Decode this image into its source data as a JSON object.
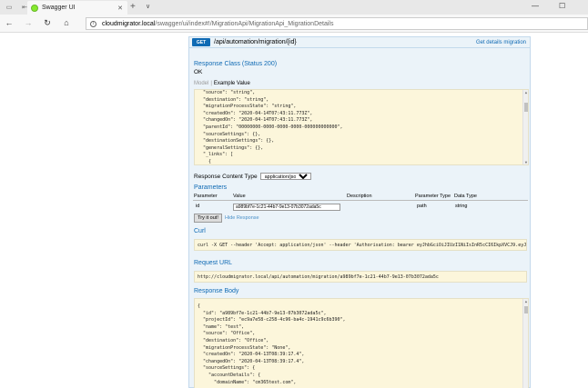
{
  "browser": {
    "tab_title": "Swagger UI",
    "url_host": "cloudmigrator.local",
    "url_path": "/swagger/ui/index#!/MigrationApi/MigrationApi_MigrationDetails"
  },
  "operation": {
    "method": "GET",
    "path": "/api/automation/migration/{id}",
    "summary": "Get details migration",
    "response_class_title": "Response Class (Status 200)",
    "response_class_value": "OK",
    "model_tab": "Model",
    "example_tab": "Example Value",
    "example_lines": [
      "  \"source\": \"string\",",
      "  \"destination\": \"string\",",
      "  \"migrationProcessState\": \"string\",",
      "  \"createdOn\": \"2020-04-14T07:43:11.773Z\",",
      "  \"changedOn\": \"2020-04-14T07:43:11.773Z\",",
      "  \"parentId\": \"00000000-0000-0000-0000-000000000000\",",
      "  \"sourceSettings\": {},",
      "  \"destinationSettings\": {},",
      "  \"generalSettings\": {},",
      "  \"_links\": [",
      "    {"
    ],
    "response_content_type_label": "Response Content Type",
    "response_content_type_value": "application/json",
    "parameters_title": "Parameters",
    "param_headers": {
      "parameter": "Parameter",
      "value": "Value",
      "description": "Description",
      "parameter_type": "Parameter Type",
      "data_type": "Data Type"
    },
    "param_row": {
      "name": "id",
      "value": "a989bf7e-1c21-44b7-9e13-07b3072ada5c",
      "parameter_type": "path",
      "data_type": "string"
    },
    "try_button": "Try it out!",
    "hide_response": "Hide Response",
    "curl_title": "Curl",
    "curl_text": "curl -X GET --header 'Accept: application/json' --header 'Authorisation: bearer eyJhbGciOiJIUzI1NiIsInR5cCI6IkpXVCJ9.eyJodHRwOi8vc",
    "request_url_title": "Request URL",
    "request_url": "http://cloudmigrator.local/api/automation/migration/a989bf7e-1c21-44b7-9e13-07b3072ada5c",
    "response_body_title": "Response Body",
    "response_lines": [
      "{",
      "  \"id\": \"a989bf7e-1c21-44b7-9e13-07b3072ada5c\",",
      "  \"projectId\": \"ec9a7e58-c258-4c96-ba4c-1941c9c6b390\",",
      "  \"name\": \"test\",",
      "  \"source\": \"Office\",",
      "  \"destination\": \"Office\",",
      "  \"migrationProcessState\": \"None\",",
      "  \"createdOn\": \"2020-04-13T08:39:17.4\",",
      "  \"changedOn\": \"2020-04-13T08:39:17.4\",",
      "  \"sourceSettings\": {",
      "    \"accountDetails\": {",
      "      \"domainName\": \"cm365test.com\","
    ]
  }
}
